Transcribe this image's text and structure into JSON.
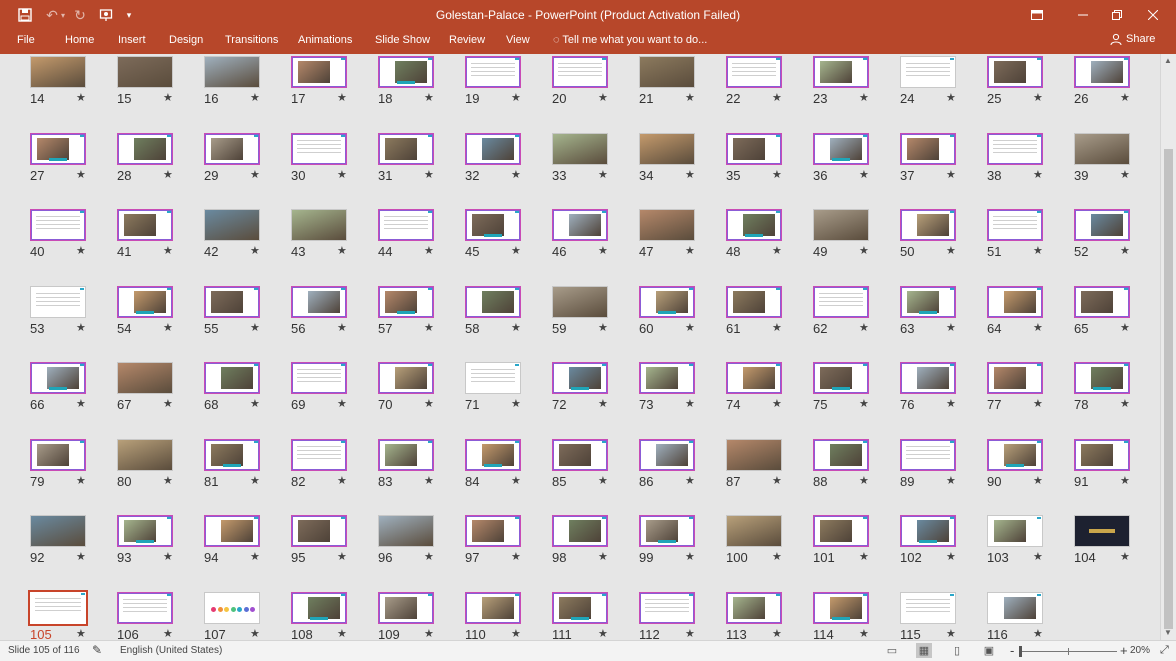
{
  "window": {
    "title": "Golestan-Palace - PowerPoint (Product Activation Failed)",
    "undo_icon": "undo-icon",
    "redo_icon": "redo-icon",
    "save_icon": "save-icon"
  },
  "ribbon": {
    "tabs": [
      "File",
      "Home",
      "Insert",
      "Design",
      "Transitions",
      "Animations",
      "Slide Show",
      "Review",
      "View"
    ],
    "tell_me": "Tell me what you want to do...",
    "share": "Share"
  },
  "sorter": {
    "star": "★",
    "selected": 105,
    "slides": [
      {
        "n": 14,
        "k": "photo"
      },
      {
        "n": 15,
        "k": "photo"
      },
      {
        "n": 16,
        "k": "photo"
      },
      {
        "n": 17,
        "k": "frame_pic"
      },
      {
        "n": 18,
        "k": "frame_pic"
      },
      {
        "n": 19,
        "k": "frame_text"
      },
      {
        "n": 20,
        "k": "frame_text"
      },
      {
        "n": 21,
        "k": "photo"
      },
      {
        "n": 22,
        "k": "frame_text"
      },
      {
        "n": 23,
        "k": "frame_pic"
      },
      {
        "n": 24,
        "k": "plain"
      },
      {
        "n": 25,
        "k": "frame_pic"
      },
      {
        "n": 26,
        "k": "frame_pic"
      },
      {
        "n": 27,
        "k": "frame_pic"
      },
      {
        "n": 28,
        "k": "frame_pic"
      },
      {
        "n": 29,
        "k": "frame_pic"
      },
      {
        "n": 30,
        "k": "frame_text"
      },
      {
        "n": 31,
        "k": "frame_pic"
      },
      {
        "n": 32,
        "k": "frame_pic"
      },
      {
        "n": 33,
        "k": "photo"
      },
      {
        "n": 34,
        "k": "photo"
      },
      {
        "n": 35,
        "k": "frame_pic"
      },
      {
        "n": 36,
        "k": "frame_pic"
      },
      {
        "n": 37,
        "k": "frame_pic"
      },
      {
        "n": 38,
        "k": "frame_text"
      },
      {
        "n": 39,
        "k": "photo"
      },
      {
        "n": 40,
        "k": "frame_text"
      },
      {
        "n": 41,
        "k": "frame_pic"
      },
      {
        "n": 42,
        "k": "photo"
      },
      {
        "n": 43,
        "k": "photo"
      },
      {
        "n": 44,
        "k": "frame_text"
      },
      {
        "n": 45,
        "k": "frame_pic"
      },
      {
        "n": 46,
        "k": "frame_pic"
      },
      {
        "n": 47,
        "k": "photo"
      },
      {
        "n": 48,
        "k": "frame_pic"
      },
      {
        "n": 49,
        "k": "photo"
      },
      {
        "n": 50,
        "k": "frame_pic"
      },
      {
        "n": 51,
        "k": "frame_text"
      },
      {
        "n": 52,
        "k": "frame_pic"
      },
      {
        "n": 53,
        "k": "plain"
      },
      {
        "n": 54,
        "k": "frame_pic"
      },
      {
        "n": 55,
        "k": "frame_pic"
      },
      {
        "n": 56,
        "k": "frame_pic"
      },
      {
        "n": 57,
        "k": "frame_pic"
      },
      {
        "n": 58,
        "k": "frame_pic"
      },
      {
        "n": 59,
        "k": "photo"
      },
      {
        "n": 60,
        "k": "frame_pic"
      },
      {
        "n": 61,
        "k": "frame_pic"
      },
      {
        "n": 62,
        "k": "frame_text"
      },
      {
        "n": 63,
        "k": "frame_pic"
      },
      {
        "n": 64,
        "k": "frame_pic"
      },
      {
        "n": 65,
        "k": "frame_pic"
      },
      {
        "n": 66,
        "k": "frame_pic"
      },
      {
        "n": 67,
        "k": "photo"
      },
      {
        "n": 68,
        "k": "frame_pic"
      },
      {
        "n": 69,
        "k": "frame_text"
      },
      {
        "n": 70,
        "k": "frame_pic"
      },
      {
        "n": 71,
        "k": "plain"
      },
      {
        "n": 72,
        "k": "frame_pic"
      },
      {
        "n": 73,
        "k": "frame_pic"
      },
      {
        "n": 74,
        "k": "frame_pic"
      },
      {
        "n": 75,
        "k": "frame_pic"
      },
      {
        "n": 76,
        "k": "frame_pic"
      },
      {
        "n": 77,
        "k": "frame_pic"
      },
      {
        "n": 78,
        "k": "frame_pic"
      },
      {
        "n": 79,
        "k": "frame_pic"
      },
      {
        "n": 80,
        "k": "photo"
      },
      {
        "n": 81,
        "k": "frame_pic"
      },
      {
        "n": 82,
        "k": "frame_text"
      },
      {
        "n": 83,
        "k": "frame_pic"
      },
      {
        "n": 84,
        "k": "frame_pic"
      },
      {
        "n": 85,
        "k": "frame_pic"
      },
      {
        "n": 86,
        "k": "frame_pic"
      },
      {
        "n": 87,
        "k": "photo"
      },
      {
        "n": 88,
        "k": "frame_pic"
      },
      {
        "n": 89,
        "k": "frame_text"
      },
      {
        "n": 90,
        "k": "frame_pic"
      },
      {
        "n": 91,
        "k": "frame_pic"
      },
      {
        "n": 92,
        "k": "photo"
      },
      {
        "n": 93,
        "k": "frame_pic"
      },
      {
        "n": 94,
        "k": "frame_pic"
      },
      {
        "n": 95,
        "k": "frame_pic"
      },
      {
        "n": 96,
        "k": "photo"
      },
      {
        "n": 97,
        "k": "frame_pic"
      },
      {
        "n": 98,
        "k": "frame_pic"
      },
      {
        "n": 99,
        "k": "frame_pic"
      },
      {
        "n": 100,
        "k": "photo"
      },
      {
        "n": 101,
        "k": "frame_pic"
      },
      {
        "n": 102,
        "k": "frame_pic"
      },
      {
        "n": 103,
        "k": "plain_pic"
      },
      {
        "n": 104,
        "k": "dark"
      },
      {
        "n": 105,
        "k": "frame_text"
      },
      {
        "n": 106,
        "k": "frame_text"
      },
      {
        "n": 107,
        "k": "plain_dots"
      },
      {
        "n": 108,
        "k": "frame_pic"
      },
      {
        "n": 109,
        "k": "frame_pic"
      },
      {
        "n": 110,
        "k": "frame_pic"
      },
      {
        "n": 111,
        "k": "frame_pic"
      },
      {
        "n": 112,
        "k": "frame_text"
      },
      {
        "n": 113,
        "k": "frame_pic"
      },
      {
        "n": 114,
        "k": "frame_pic"
      },
      {
        "n": 115,
        "k": "plain"
      },
      {
        "n": 116,
        "k": "plain_pic"
      }
    ]
  },
  "status": {
    "slide_counter": "Slide 105 of 116",
    "language": "English (United States)",
    "zoom": "20%",
    "zoom_minus": "-",
    "zoom_plus": "+"
  }
}
